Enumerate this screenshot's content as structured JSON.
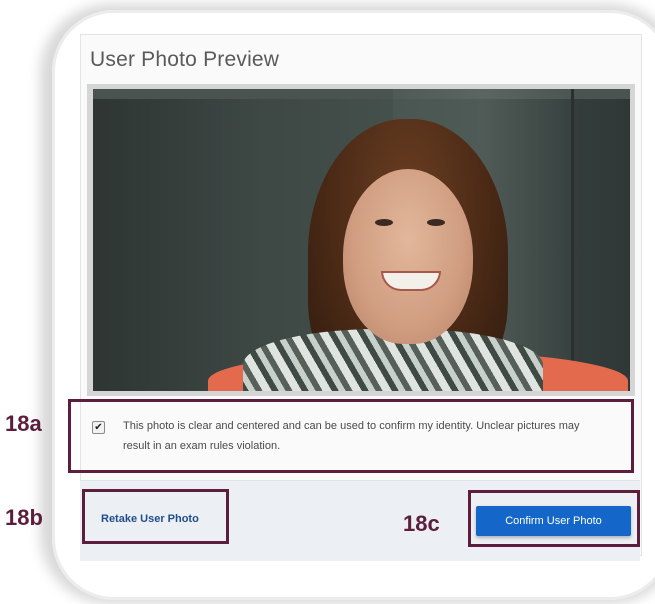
{
  "dialog": {
    "title": "User Photo Preview",
    "confirmation": {
      "checked": true,
      "text": "This photo is clear and centered and can be used to confirm my identity. Unclear pictures may result in an exam rules violation."
    },
    "retake_label": "Retake User Photo",
    "confirm_label": "Confirm User Photo"
  },
  "callouts": {
    "a": "18a",
    "b": "18b",
    "c": "18c"
  },
  "colors": {
    "accent": "#1467c8",
    "callout": "#5c1e3c",
    "link": "#1f4e8c"
  }
}
